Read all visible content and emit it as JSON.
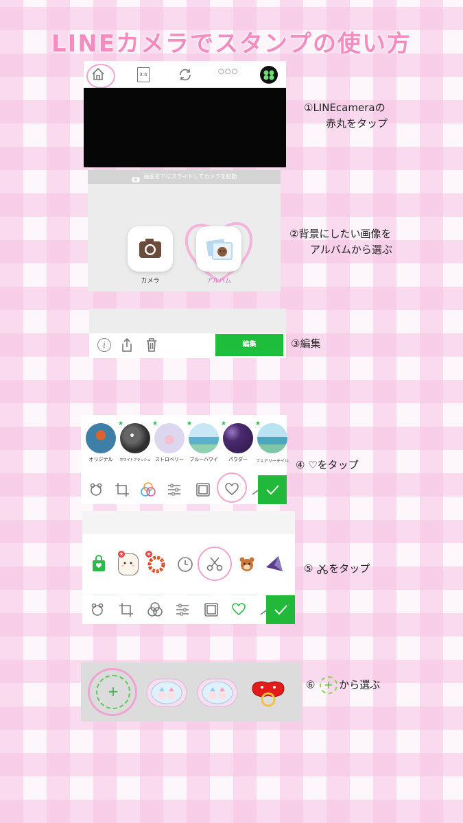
{
  "title": "LINEカメラでスタンプの使い方",
  "steps": {
    "step1": {
      "line1": "①LINEcameraの",
      "line2": "赤丸をタップ"
    },
    "step2": {
      "line1": "②背景にしたい画像を",
      "line2": "アルバムから選ぶ"
    },
    "step3": {
      "line1": "③編集"
    },
    "step4": {
      "line1": "④ ♡をタップ"
    },
    "step5": {
      "num": "⑤",
      "suffix": "をタップ"
    },
    "step6": {
      "num": "⑥",
      "suffix": "から選ぶ"
    }
  },
  "camera_app": {
    "ratio_label": "3:4",
    "more_label": "○○○"
  },
  "launcher": {
    "hint": "画面を下にスライドしてカメラを起動",
    "camera_label": "カメラ",
    "album_label": "アルバム"
  },
  "editor": {
    "info_icon": "i",
    "edit_label": "編集"
  },
  "filters": [
    {
      "label": "オリジナル",
      "color": "#3b6c8a"
    },
    {
      "label": "ホワイトフラッシュ",
      "color": "#3a3a3a"
    },
    {
      "label": "ストロベリー",
      "color": "#dcd6ef"
    },
    {
      "label": "ブルーハワイ",
      "color": "#9ed1ea"
    },
    {
      "label": "パウダー",
      "color": "#4a2a6e"
    },
    {
      "label": "フェアリーテイル",
      "color": "#8fd0e0"
    }
  ],
  "colors": {
    "title": "#f58cc0",
    "highlight": "#f0a3d0",
    "green": "#1ebd3c"
  }
}
